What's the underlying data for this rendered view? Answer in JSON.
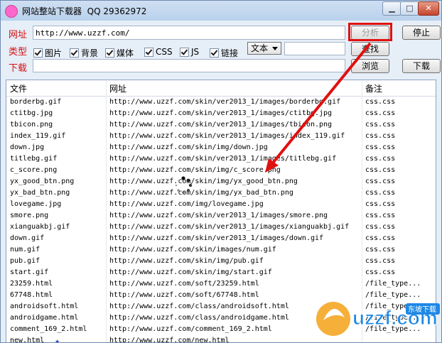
{
  "window": {
    "title": "网站整站下载器  QQ 29362972",
    "min_label": "▁",
    "max_label": "□",
    "close_label": "✕"
  },
  "form": {
    "url_label": "网址",
    "url_value": "http://www.uzzf.com/",
    "type_label": "类型",
    "download_label": "下载",
    "download_value": "",
    "checkboxes": [
      {
        "label": "图片",
        "checked": true
      },
      {
        "label": "背景",
        "checked": true
      },
      {
        "label": "媒体",
        "checked": true
      },
      {
        "label": "CSS",
        "checked": true
      },
      {
        "label": "JS",
        "checked": true
      },
      {
        "label": "链接",
        "checked": true
      }
    ],
    "mode_select": "文本",
    "find_value": ""
  },
  "buttons": {
    "analyze": "分析",
    "stop": "停止",
    "find": "查找",
    "browse": "浏览",
    "download": "下载"
  },
  "table": {
    "headers": [
      "文件",
      "网址",
      "备注"
    ],
    "rows": [
      [
        "borderbg.gif",
        "http://www.uzzf.com/skin/ver2013_1/images/borderbg.gif",
        "css.css"
      ],
      [
        "ctitbg.jpg",
        "http://www.uzzf.com/skin/ver2013_1/images/ctitbg.jpg",
        "css.css"
      ],
      [
        "tbicon.png",
        "http://www.uzzf.com/skin/ver2013_1/images/tbicon.png",
        "css.css"
      ],
      [
        "index_119.gif",
        "http://www.uzzf.com/skin/ver2013_1/images/index_119.gif",
        "css.css"
      ],
      [
        "down.jpg",
        "http://www.uzzf.com/skin/img/down.jpg",
        "css.css"
      ],
      [
        "titlebg.gif",
        "http://www.uzzf.com/skin/ver2013_1/images/titlebg.gif",
        "css.css"
      ],
      [
        "c_score.png",
        "http://www.uzzf.com/skin/img/c_score.png",
        "css.css"
      ],
      [
        "yx_good_btn.png",
        "http://www.uzzf.com/skin/img/yx_good_btn.png",
        "css.css"
      ],
      [
        "yx_bad_btn.png",
        "http://www.uzzf.com/skin/img/yx_bad_btn.png",
        "css.css"
      ],
      [
        "lovegame.jpg",
        "http://www.uzzf.com/img/lovegame.jpg",
        "css.css"
      ],
      [
        "smore.png",
        "http://www.uzzf.com/skin/ver2013_1/images/smore.png",
        "css.css"
      ],
      [
        "xianguakbj.gif",
        "http://www.uzzf.com/skin/ver2013_1/images/xianguakbj.gif",
        "css.css"
      ],
      [
        "down.gif",
        "http://www.uzzf.com/skin/ver2013_1/images/down.gif",
        "css.css"
      ],
      [
        "num.gif",
        "http://www.uzzf.com/skin/images/num.gif",
        "css.css"
      ],
      [
        "pub.gif",
        "http://www.uzzf.com/skin/img/pub.gif",
        "css.css"
      ],
      [
        "start.gif",
        "http://www.uzzf.com/skin/img/start.gif",
        "css.css"
      ],
      [
        "23259.html",
        "http://www.uzzf.com/soft/23259.html",
        "/file_type...."
      ],
      [
        "67748.html",
        "http://www.uzzf.com/soft/67748.html",
        "/file_type...."
      ],
      [
        "androidsoft.html",
        "http://www.uzzf.com/class/androidsoft.html",
        "/file_type...."
      ],
      [
        "androidgame.html",
        "http://www.uzzf.com/class/androidgame.html",
        "/file_type...."
      ],
      [
        "comment_169_2.html",
        "http://www.uzzf.com/comment_169_2.html",
        "/file_type...."
      ],
      [
        "new.html",
        "http://www.uzzf.com/new.html",
        ""
      ]
    ]
  },
  "watermark": {
    "logo": "uzzf.com",
    "tag": "东坡下载"
  }
}
